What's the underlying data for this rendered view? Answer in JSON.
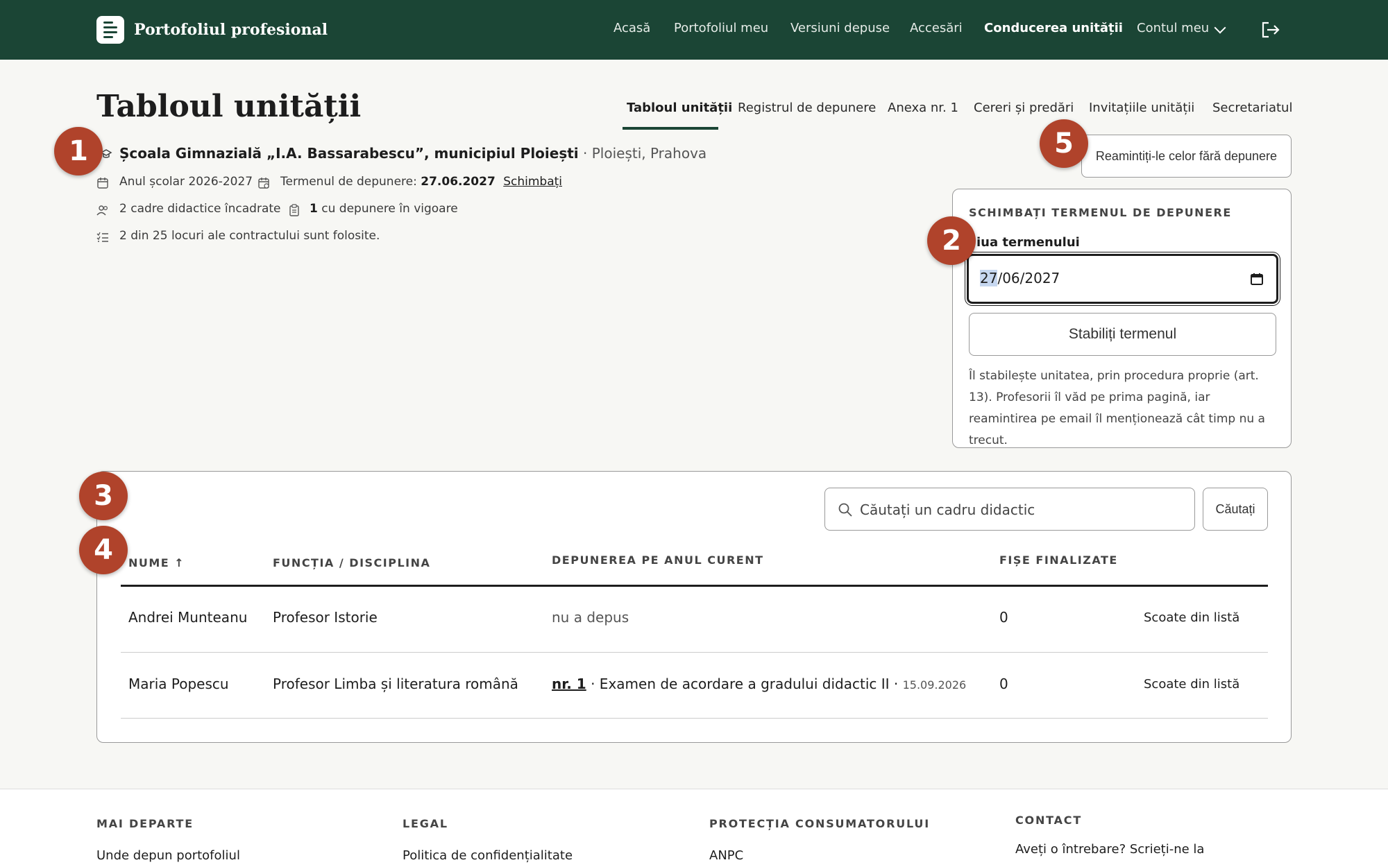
{
  "brand": {
    "title": "Portofoliul profesional"
  },
  "nav": {
    "items": [
      {
        "label": "Acasă"
      },
      {
        "label": "Portofoliul meu"
      },
      {
        "label": "Versiuni depuse"
      },
      {
        "label": "Accesări"
      },
      {
        "label": "Conducerea unității",
        "active": true
      },
      {
        "label": "Contul meu"
      }
    ]
  },
  "page": {
    "title": "Tabloul unității"
  },
  "tabs": [
    {
      "label": "Tabloul unității",
      "active": true
    },
    {
      "label": "Registrul de depunere"
    },
    {
      "label": "Anexa nr. 1"
    },
    {
      "label": "Cereri și predări"
    },
    {
      "label": "Invitațiile unității"
    },
    {
      "label": "Secretariatul"
    }
  ],
  "unit": {
    "name": "Școala Gimnazială „I.A. Bassarabescu”, municipiul Ploiești",
    "location": " · Ploiești, Prahova",
    "school_year": "Anul școlar 2026-2027",
    "deadline_label": "Termenul de depunere: ",
    "deadline_value": "27.06.2027",
    "change_link": "Schimbați",
    "staff": "2 cadre didactice încadrate",
    "active_count": "1",
    "active_text": " cu depunere în vigoare",
    "contract": "2 din 25 locuri ale contractului sunt folosite."
  },
  "markers": [
    "1",
    "2",
    "3",
    "4",
    "5"
  ],
  "remind_button": "Reamintiți-le celor fără depunere",
  "deadline_panel": {
    "title": "SCHIMBAȚI TERMENUL DE DEPUNERE",
    "label": "iua termenului",
    "date_day": "27",
    "date_rest": "/06/2027",
    "set_button": "Stabiliți termenul",
    "help": "Îl stabilește unitatea, prin procedura proprie (art. 13). Profesorii îl văd pe prima pagină, iar reamintirea pe email îl menționează cât timp nu a trecut."
  },
  "search": {
    "placeholder": "Căutați un cadru didactic",
    "button": "Căutați"
  },
  "table": {
    "headers": {
      "name": "NUME ↑",
      "role": "FUNCȚIA / DISCIPLINA",
      "submission": "DEPUNEREA PE ANUL CURENT",
      "finalized": "FIȘE FINALIZATE"
    },
    "rows": [
      {
        "name": "Andrei Munteanu",
        "role": "Profesor Istorie",
        "submission": "nu a depus",
        "finalized": "0",
        "action": "Scoate din listă"
      },
      {
        "name": "Maria Popescu",
        "role": "Profesor Limba și literatura română",
        "submission_link": "nr. 1",
        "submission_text": " · Examen de acordare a gradului didactic II · ",
        "submission_date": "15.09.2026",
        "finalized": "0",
        "action": "Scoate din listă"
      }
    ]
  },
  "footer": {
    "cols": [
      {
        "head": "MAI DEPARTE",
        "link": "Unde depun portofoliul"
      },
      {
        "head": "LEGAL",
        "link": "Politica de confidențialitate"
      },
      {
        "head": "PROTECȚIA CONSUMATORULUI",
        "link": "ANPC"
      },
      {
        "head": "CONTACT",
        "link": "Aveți o întrebare? Scrieți-ne la"
      }
    ]
  }
}
